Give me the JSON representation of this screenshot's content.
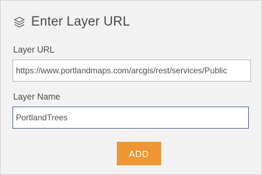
{
  "header": {
    "icon": "layers-icon",
    "title": "Enter Layer URL"
  },
  "form": {
    "url_label": "Layer URL",
    "url_value": "https://www.portlandmaps.com/arcgis/rest/services/Public",
    "name_label": "Layer Name",
    "name_value": "PortlandTrees",
    "add_label": "ADD"
  },
  "colors": {
    "accent": "#ee9534",
    "panel_bg": "#f2f2f2",
    "focus_border": "#5a6e8e"
  }
}
